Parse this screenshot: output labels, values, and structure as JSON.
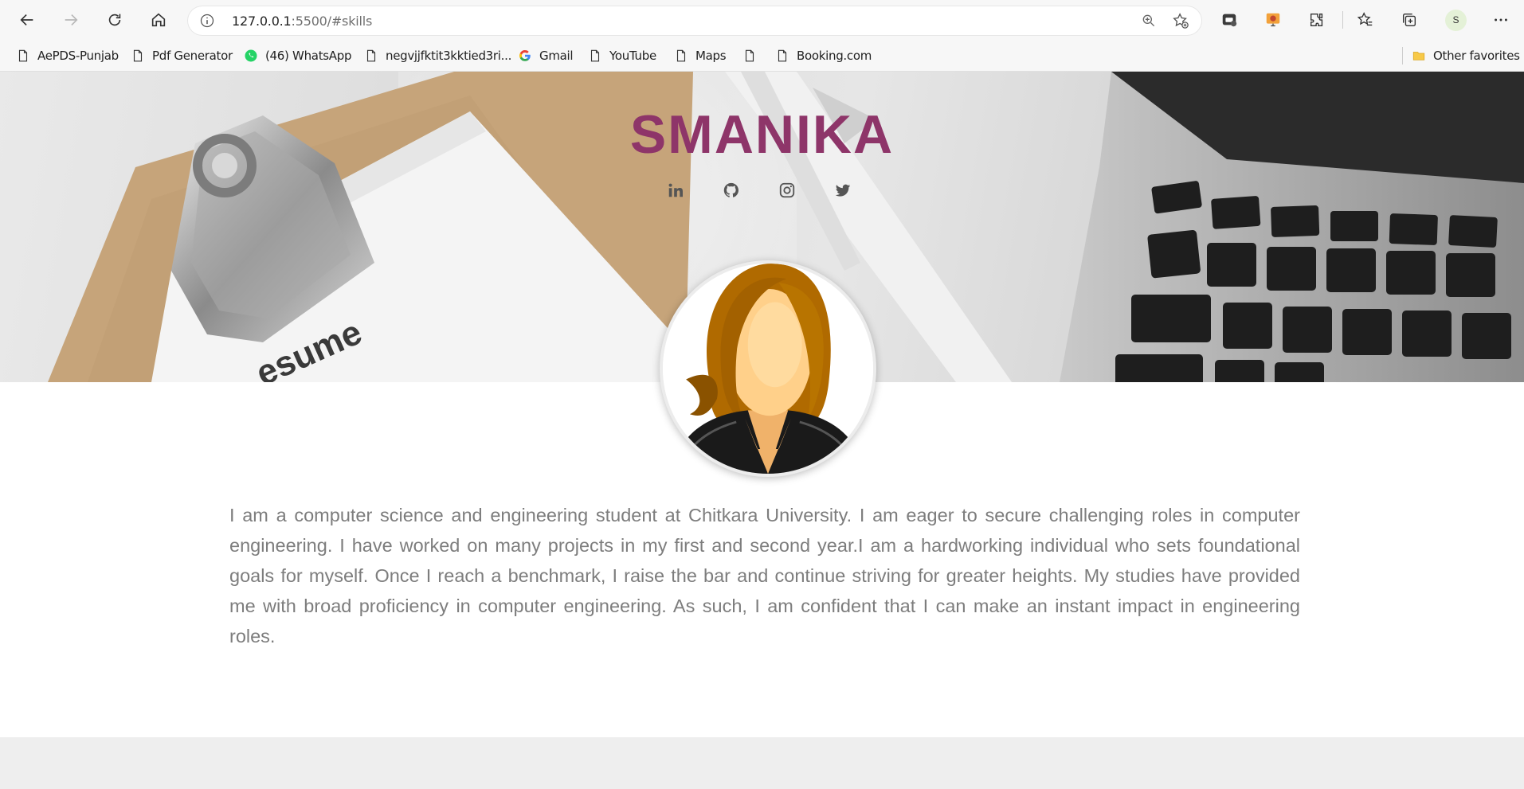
{
  "browser": {
    "url_host": "127.0.0.1",
    "url_rest": ":5500/#skills",
    "profile_initial": "S",
    "bookmarks": [
      {
        "label": "AePDS-Punjab",
        "icon": "page-icon"
      },
      {
        "label": "Pdf Generator",
        "icon": "page-icon"
      },
      {
        "label": "(46) WhatsApp",
        "icon": "whatsapp-icon"
      },
      {
        "label": "negvjjfktit3kktied3ri...",
        "icon": "page-icon"
      },
      {
        "label": "Gmail",
        "icon": "google-icon"
      },
      {
        "label": "YouTube",
        "icon": "page-icon"
      },
      {
        "label": "Maps",
        "icon": "page-icon"
      },
      {
        "label": "",
        "icon": "page-icon"
      },
      {
        "label": "Booking.com",
        "icon": "page-icon"
      }
    ],
    "other_favorites": "Other favorites"
  },
  "page": {
    "name": "SMANIKA",
    "socials": [
      "linkedin-icon",
      "github-icon",
      "instagram-icon",
      "twitter-icon"
    ],
    "about": "I am a computer science and engineering student at Chitkara University. I am eager to secure challenging roles in computer engineering. I have worked on many projects in my first and second year.I am a hardworking individual who sets foundational goals for myself. Once I reach a benchmark, I raise the bar and continue striving for greater heights. My studies have provided me with broad proficiency in computer engineering. As such, I am confident that I can make an instant impact in engineering roles."
  },
  "colors": {
    "name": "#8e3569",
    "text": "#7d7d7d",
    "footer": "#eeeeee"
  }
}
